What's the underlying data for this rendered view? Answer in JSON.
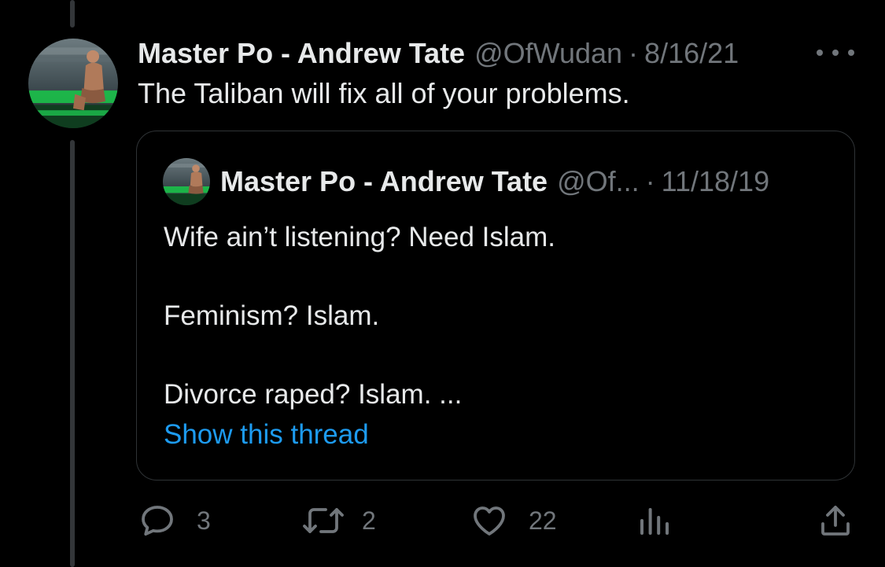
{
  "tweet": {
    "author_name": "Master Po - Andrew Tate",
    "handle": "@OfWudan",
    "separator": "·",
    "date": "8/16/21",
    "text": "The Taliban will fix all of your problems."
  },
  "quoted_tweet": {
    "author_name": "Master Po - Andrew Tate",
    "handle": "@Of...",
    "separator": "·",
    "date": "11/18/19",
    "lines": [
      "Wife ain’t listening? Need Islam.",
      "Feminism? Islam.",
      "Divorce raped? Islam. ..."
    ],
    "show_thread_label": "Show this thread"
  },
  "actions": {
    "reply_count": "3",
    "retweet_count": "2",
    "like_count": "22"
  },
  "icons": {
    "more": "more-horizontal-icon",
    "reply": "reply-bubble-icon",
    "retweet": "retweet-icon",
    "like": "heart-icon",
    "analytics": "analytics-bars-icon",
    "share": "share-upload-icon"
  },
  "colors": {
    "background": "#000000",
    "primary_text": "#e7e9ea",
    "secondary_text": "#71767b",
    "link": "#1d9bf0",
    "border": "#2f3336",
    "thread_line": "#333639"
  }
}
